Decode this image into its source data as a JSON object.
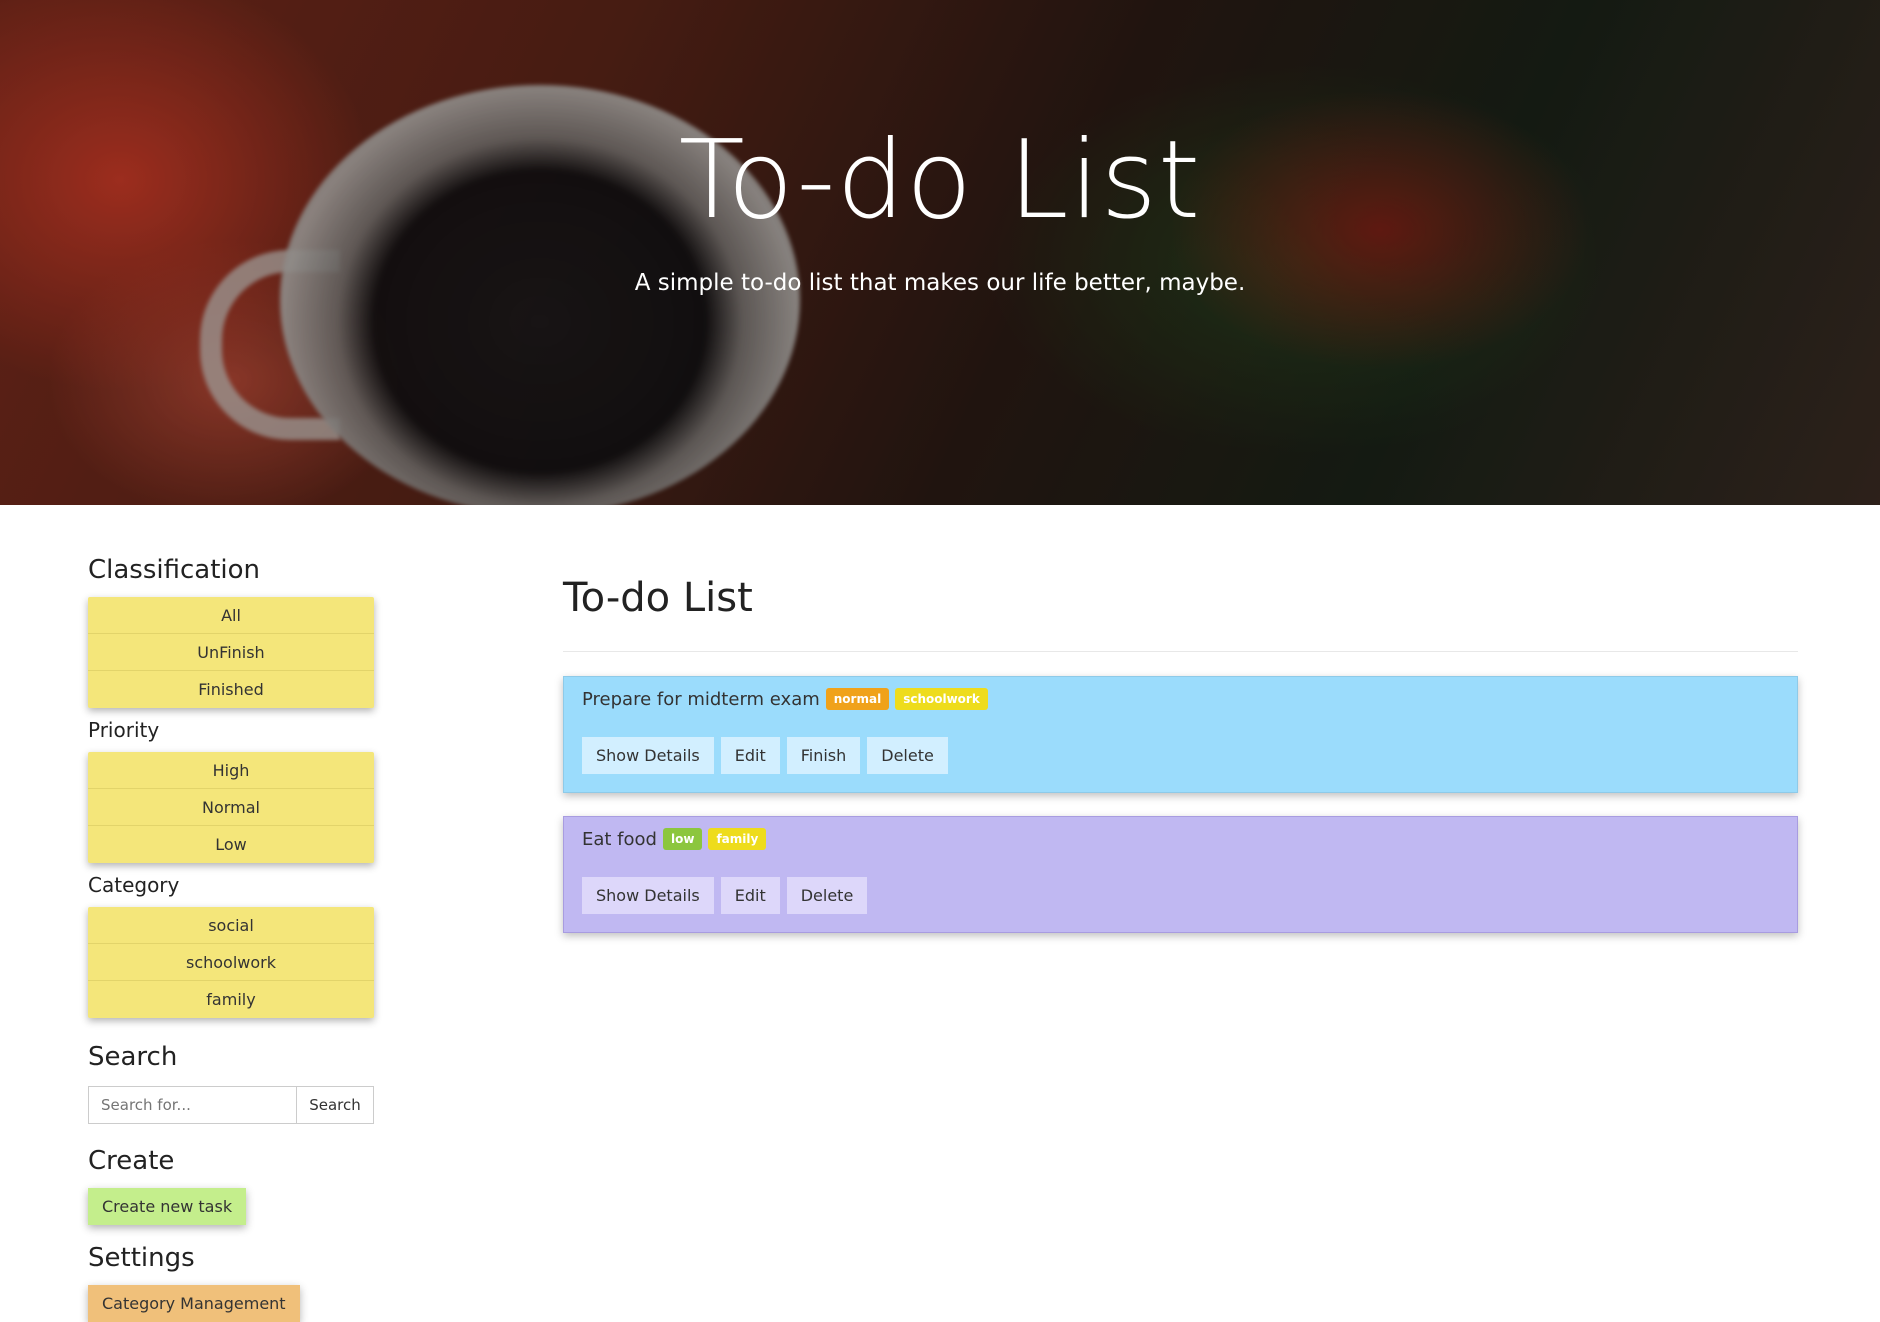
{
  "header": {
    "title": "To-do List",
    "subtitle": "A simple to-do list that makes our life better, maybe."
  },
  "sidebar": {
    "classification_heading": "Classification",
    "classification_items": [
      "All",
      "UnFinish",
      "Finished"
    ],
    "priority_heading": "Priority",
    "priority_items": [
      "High",
      "Normal",
      "Low"
    ],
    "category_heading": "Category",
    "category_items": [
      "social",
      "schoolwork",
      "family"
    ],
    "search_heading": "Search",
    "search_placeholder": "Search for...",
    "search_button": "Search",
    "create_heading": "Create",
    "create_button": "Create new task",
    "settings_heading": "Settings",
    "settings_button": "Category Management"
  },
  "main": {
    "title": "To-do List",
    "tasks": [
      {
        "title": "Prepare for midterm exam",
        "priority": "normal",
        "priority_color": "#f0a21a",
        "category": "schoolwork",
        "category_color": "#eedc1c",
        "card_color": "#9bdcfc",
        "actions": [
          "Show Details",
          "Edit",
          "Finish",
          "Delete"
        ]
      },
      {
        "title": "Eat food",
        "priority": "low",
        "priority_color": "#8cc63e",
        "category": "family",
        "category_color": "#eedc1c",
        "card_color": "#c0b8f2",
        "actions": [
          "Show Details",
          "Edit",
          "Delete"
        ]
      }
    ]
  }
}
